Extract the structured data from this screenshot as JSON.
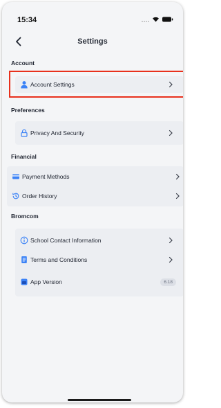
{
  "status_bar": {
    "time": "15:34"
  },
  "navbar": {
    "title": "Settings"
  },
  "sections": {
    "account": {
      "label": "Account",
      "items": [
        {
          "label": "Account Settings",
          "icon": "person-icon"
        }
      ]
    },
    "preferences": {
      "label": "Preferences",
      "items": [
        {
          "label": "Privacy And Security",
          "icon": "lock-icon"
        }
      ]
    },
    "financial": {
      "label": "Financial",
      "items": [
        {
          "label": "Payment Methods",
          "icon": "credit-card-icon"
        },
        {
          "label": "Order History",
          "icon": "history-icon"
        }
      ]
    },
    "bromcom": {
      "label": "Bromcom",
      "items": [
        {
          "label": "School Contact Information",
          "icon": "info-icon"
        },
        {
          "label": "Terms and Conditions",
          "icon": "document-icon"
        },
        {
          "label": "App Version",
          "icon": "app-icon",
          "value": "6.18"
        }
      ]
    }
  },
  "colors": {
    "accent": "#2f6fe0",
    "highlight": "#e8301c",
    "background": "#f4f5f7"
  }
}
